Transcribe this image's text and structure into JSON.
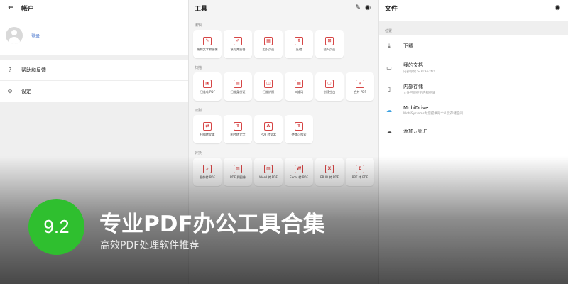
{
  "account": {
    "title": "帐户",
    "login": "登录",
    "menu": [
      {
        "icon": "help-icon",
        "label": "帮助和反馈"
      },
      {
        "icon": "gear-icon",
        "label": "设定"
      }
    ]
  },
  "tools": {
    "title": "工具",
    "sections": [
      {
        "label": "编辑",
        "items": [
          "编辑文本和图像",
          "填写并签署",
          "组织页面",
          "压缩",
          "插入页面"
        ]
      },
      {
        "label": "扫描",
        "items": [
          "扫描成 PDF",
          "扫描身份证",
          "扫描护照",
          "二维码",
          "创建空白",
          "合并 PDF"
        ]
      },
      {
        "label": "识别",
        "items": [
          "扫描转文本",
          "图片转文字",
          "PDF 转文本",
          "使其可搜索"
        ]
      },
      {
        "label": "转换",
        "items": [
          "图像转 PDF",
          "PDF 到图像",
          "Word 转 PDF",
          "Excel 转 PDF",
          "EPUB 转 PDF",
          "PPT 转 PDF"
        ]
      }
    ]
  },
  "files": {
    "title": "文件",
    "section": "位置",
    "items": [
      {
        "icon": "download-icon",
        "title": "下载",
        "sub": ""
      },
      {
        "icon": "folder-icon",
        "title": "我的文档",
        "sub": "内部存储 > PDFExtra"
      },
      {
        "icon": "phone-icon",
        "title": "内部存储",
        "sub": "文件已保存至内部存储"
      },
      {
        "icon": "cloud-icon",
        "title": "MobiDrive",
        "sub": "MobiSystems为您提供的个人云存储空间"
      },
      {
        "icon": "cloud-add-icon",
        "title": "添加云账户",
        "sub": ""
      }
    ]
  },
  "overlay": {
    "score": "9.2",
    "title": "专业PDF办公工具合集",
    "subtitle": "高效PDF处理软件推荐",
    "score_color": "#2fbf2f"
  }
}
